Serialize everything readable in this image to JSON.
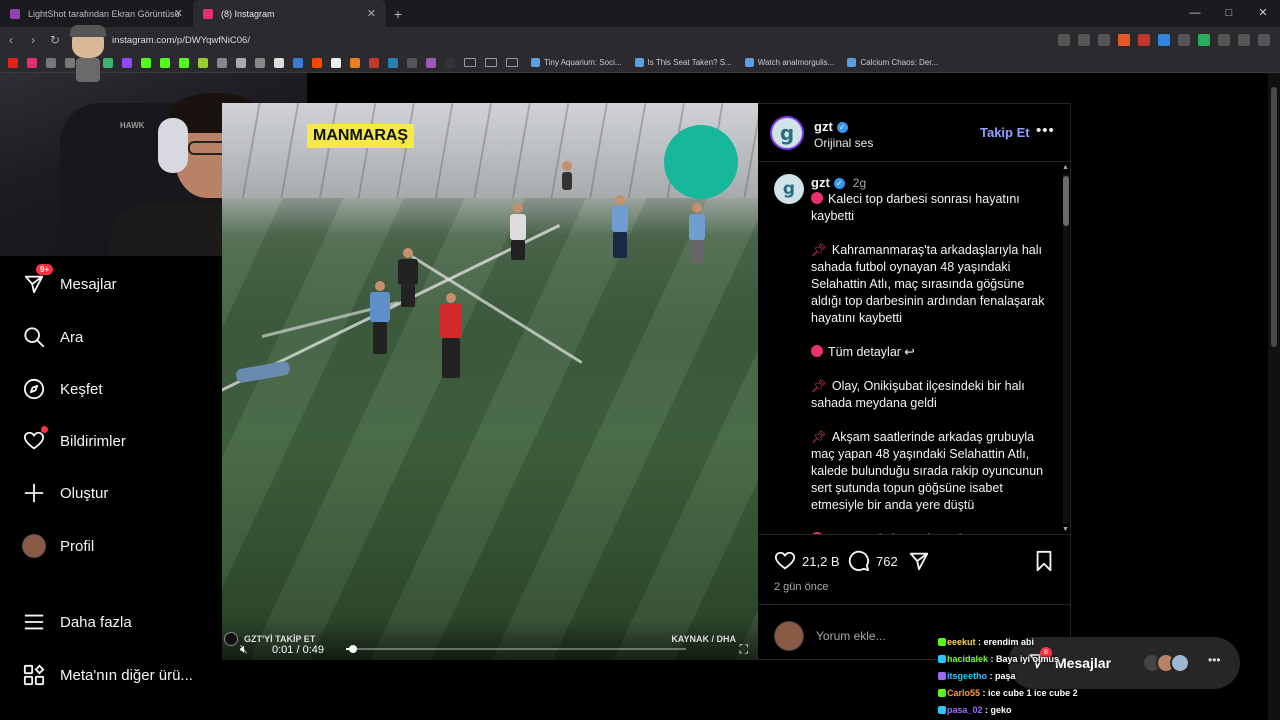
{
  "browser": {
    "tabs": [
      {
        "label": "LightShot tarafından Ekran Görüntüsü",
        "active": false,
        "color": "#8e44ad"
      },
      {
        "label": "(8) Instagram",
        "active": true,
        "color": "#e1306c"
      }
    ],
    "new_tab": "+",
    "window_controls": [
      "—",
      "□",
      "✕"
    ],
    "url": "instagram.com/p/DWYqwfNiC06/",
    "bookmarks": [
      {
        "label": "Tiny Aquarium: Soci..."
      },
      {
        "label": "Is This Seat Taken? S..."
      },
      {
        "label": "Watch analmorgulis..."
      },
      {
        "label": "Calcium Chaos: Der..."
      }
    ]
  },
  "nav": {
    "messages_badge": "9+",
    "items": [
      {
        "label": "Mesajlar",
        "icon": "send-icon"
      },
      {
        "label": "Ara",
        "icon": "search-icon"
      },
      {
        "label": "Keşfet",
        "icon": "compass-icon"
      },
      {
        "label": "Bildirimler",
        "icon": "heart-icon"
      },
      {
        "label": "Oluştur",
        "icon": "plus-icon"
      },
      {
        "label": "Profil",
        "icon": "avatar-icon"
      },
      {
        "label": "Daha fazla",
        "icon": "menu-icon"
      },
      {
        "label": "Meta'nın diğer ürü...",
        "icon": "grid-icon"
      }
    ]
  },
  "video": {
    "caption_tag": "MANMARAŞ",
    "overlay_left": "GZT'Yİ TAKİP ET",
    "overlay_right": "KAYNAK / DHA",
    "time": "0:01 / 0:49",
    "progress": 0.02
  },
  "post": {
    "account": "gzt",
    "avatar_letter": "g",
    "subtitle": "Orijinal ses",
    "follow_label": "Takip Et",
    "more_label": "•••",
    "caption_time": "2g",
    "caption_paragraphs": [
      {
        "marker": "dot",
        "text": "Kaleci top darbesi sonrası hayatını kaybetti"
      },
      {
        "marker": "pin",
        "text": "Kahramanmaraş'ta arkadaşlarıyla halı sahada futbol oynayan 48 yaşındaki Selahattin Atlı, maç sırasında göğsüne aldığı top darbesinin ardından fenalaşarak hayatını kaybetti"
      },
      {
        "marker": "dot",
        "text": "Tüm detaylar ↩"
      },
      {
        "marker": "pin",
        "text": "Olay, Onikişubat ilçesindeki bir halı sahada meydana geldi"
      },
      {
        "marker": "pin",
        "text": "Akşam saatlerinde arkadaş grubuyla maç yapan 48 yaşındaki Selahattin Atlı, kalede bulunduğu sırada rakip oyuncunun sert şutunda topun göğsüne isabet etmesiyle bir anda yere düştü"
      },
      {
        "marker": "dot",
        "text": "Hastanede kurtarılamadı ↩"
      }
    ],
    "likes": "21,2 B",
    "comments": "762",
    "date": "2 gün önce",
    "comment_placeholder": "Yorum ekle..."
  },
  "messages_pill": {
    "label": "Mesajlar",
    "badge": "8"
  },
  "chat": [
    {
      "user": "eeekut",
      "text": "erendim abi",
      "color": "#ffd54a"
    },
    {
      "user": "hacidalek",
      "text": "Baya iyi olmuş",
      "color": "#7cfc00"
    },
    {
      "user": "itsgeetho",
      "text": "paşa",
      "color": "#2ec4ff"
    },
    {
      "user": "Carlo55",
      "text": "ice cube 1 ice cube 2",
      "color": "#ff9a3c"
    },
    {
      "user": "pasa_02",
      "text": "geko",
      "color": "#9b6bff"
    }
  ],
  "colors": {
    "accent_follow": "#8ea2ff",
    "notification_red": "#ff3040",
    "caption_tag_bg": "#f5e84a",
    "teal_circle": "#17b89a"
  }
}
